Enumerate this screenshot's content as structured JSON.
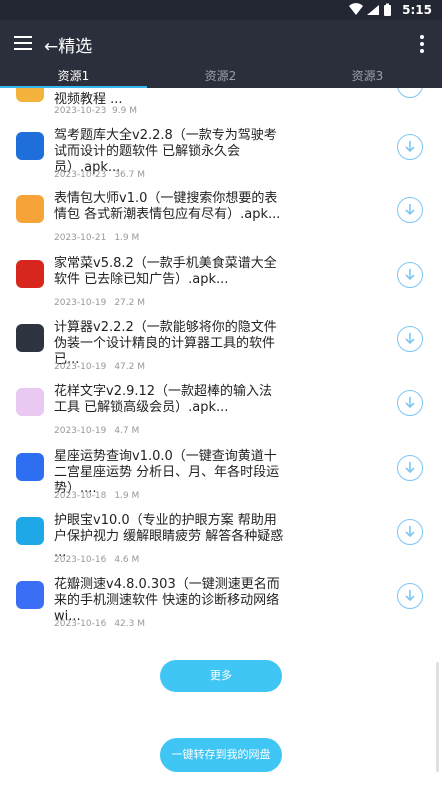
{
  "status": {
    "time": "5:15"
  },
  "appbar": {
    "title": "←精选"
  },
  "tabs": [
    "资源1",
    "资源2",
    "资源3"
  ],
  "partial_item": {
    "title": "视频教程 ...",
    "date": "2023-10-23",
    "size": "9.9 M"
  },
  "items": [
    {
      "title": "驾考题库大全v2.2.8（一款专为驾驶考试而设计的题软件 已解锁永久会员）.apk...",
      "date": "2023-10-23",
      "size": "36.7 M",
      "icon_color": "#1e6fd9",
      "icon": "exam-app-icon"
    },
    {
      "title": "表情包大师v1.0（一键搜索你想要的表情包 各式新潮表情包应有尽有）.apk...",
      "date": "2023-10-21",
      "size": "1.9 M",
      "icon_color": "#f6a43a",
      "icon": "emoji-app-icon"
    },
    {
      "title": "家常菜v5.8.2（一款手机美食菜谱大全软件 已去除已知广告）.apk...",
      "date": "2023-10-19",
      "size": "27.2 M",
      "icon_color": "#d7271d",
      "icon": "recipe-app-icon"
    },
    {
      "title": "计算器v2.2.2（一款能够将你的隐文件伪装一个设计精良的计算器工具的软件 已...",
      "date": "2023-10-19",
      "size": "47.2 M",
      "icon_color": "#2d3440",
      "icon": "calculator-app-icon"
    },
    {
      "title": "花样文字v2.9.12（一款超棒的输入法工具 已解锁高级会员）.apk...",
      "date": "2023-10-19",
      "size": "4.7 M",
      "icon_color": "#e9c8f2",
      "icon": "font-app-icon"
    },
    {
      "title": "星座运势查询v1.0.0（一键查询黄道十二宫星座运势 分析日、月、年各时段运势）....",
      "date": "2023-10-18",
      "size": "1.9 M",
      "icon_color": "#2d6ff0",
      "icon": "star-app-icon"
    },
    {
      "title": "护眼宝v10.0（专业的护眼方案 帮助用户保护视力 缓解眼睛疲劳 解答各种疑惑 ...",
      "date": "2023-10-16",
      "size": "4.6 M",
      "icon_color": "#1fa8e8",
      "icon": "eye-care-app-icon"
    },
    {
      "title": "花瓣测速v4.8.0.303（一键测速更名而来的手机测速软件 快速的诊断移动网络 wi...",
      "date": "2023-10-16",
      "size": "42.3 M",
      "icon_color": "#3a6ff5",
      "icon": "speedtest-app-icon"
    }
  ],
  "buttons": {
    "more": "更多",
    "save": "一键转存到我的网盘"
  }
}
